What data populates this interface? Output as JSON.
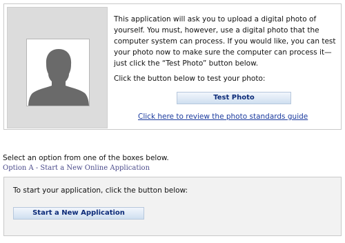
{
  "photo_panel": {
    "paragraph1": "This application will ask you to upload a digital photo of yourself. You must, however, use a digital photo that the computer system can process. If you would like, you can test your photo now to make sure the computer can process it—just click the “Test Photo” button below.",
    "paragraph2": "Click the button below to test your photo:",
    "test_button_label": "Test Photo",
    "guide_link": "Click here to review the photo standards guide",
    "placeholder_icon": "person-silhouette-icon"
  },
  "options": {
    "select_text": "Select an option from one of the boxes below.",
    "option_a_title": "Option A - Start a New Online Application",
    "option_a_text": "To start your application, click the button below:",
    "start_button_label": "Start a New Application"
  },
  "colors": {
    "button_text": "#0b2a78",
    "link": "#1a3a9e",
    "option_title": "#4a4a8a"
  }
}
